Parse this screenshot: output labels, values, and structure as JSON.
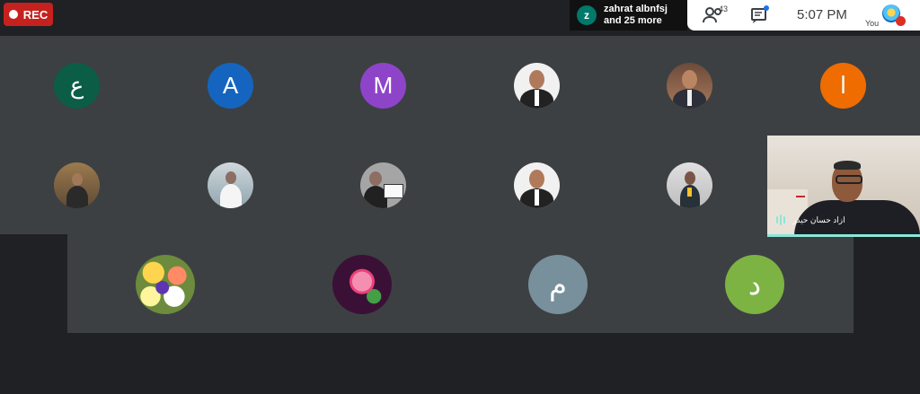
{
  "topbar": {
    "rec_label": "REC",
    "active_speaker": {
      "initial": "z",
      "line1": "zahrat albnfsj",
      "line2": "and 25 more"
    },
    "people_count": "43",
    "time": "5:07  PM",
    "self_label": "You"
  },
  "participants_row1": [
    {
      "type": "initial",
      "letter": "ع",
      "color": "#0b5d46"
    },
    {
      "type": "initial",
      "letter": "A",
      "color": "#1565c0"
    },
    {
      "type": "initial",
      "letter": "M",
      "color": "#8e44c9"
    },
    {
      "type": "photo",
      "name": "man-suit-photo"
    },
    {
      "type": "photo",
      "name": "man-suit-photo-2"
    },
    {
      "type": "initial",
      "letter": "ا",
      "color": "#ef6c00"
    }
  ],
  "participants_row2": [
    {
      "type": "photo",
      "name": "person-indoor-photo"
    },
    {
      "type": "photo",
      "name": "person-white-robe-photo"
    },
    {
      "type": "photo",
      "name": "person-with-sign-photo"
    },
    {
      "type": "photo",
      "name": "man-suit-photo-3"
    },
    {
      "type": "photo",
      "name": "woman-photo"
    }
  ],
  "participants_row3": [
    {
      "type": "photo",
      "name": "flowers-photo"
    },
    {
      "type": "photo",
      "name": "pink-rose-photo"
    },
    {
      "type": "initial",
      "letter": "م",
      "color": "#78909c"
    },
    {
      "type": "initial",
      "letter": "د",
      "color": "#7cb342"
    }
  ],
  "pinned": {
    "name": "ازاد حسان حيدر"
  },
  "colors": {
    "rec": "#c5221f",
    "bg": "#202124",
    "tile": "#3c4043",
    "accent": "#8ae7d9"
  }
}
